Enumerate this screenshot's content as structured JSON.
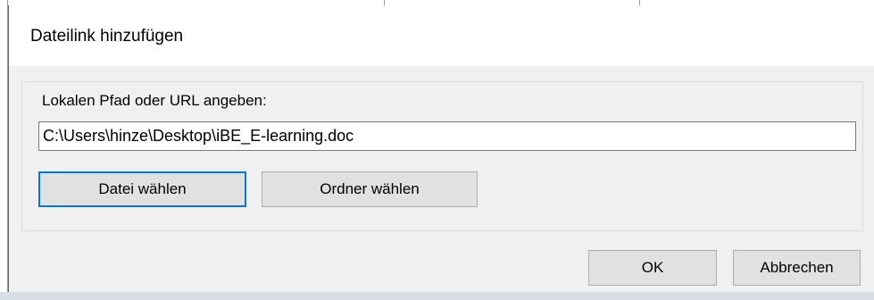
{
  "dialog": {
    "title": "Dateilink hinzufügen",
    "group_label": "Lokalen Pfad oder URL angeben:",
    "path_value": "C:\\Users\\hinze\\Desktop\\iBE_E-learning.doc",
    "choose_file_label": "Datei wählen",
    "choose_folder_label": "Ordner wählen",
    "ok_label": "OK",
    "cancel_label": "Abbrechen"
  },
  "colors": {
    "dialog_bg": "#f0f0f0",
    "title_bg": "#ffffff",
    "button_bg": "#e1e1e1",
    "focus_border": "#0078d7",
    "window_edge": "#2b73c4"
  }
}
